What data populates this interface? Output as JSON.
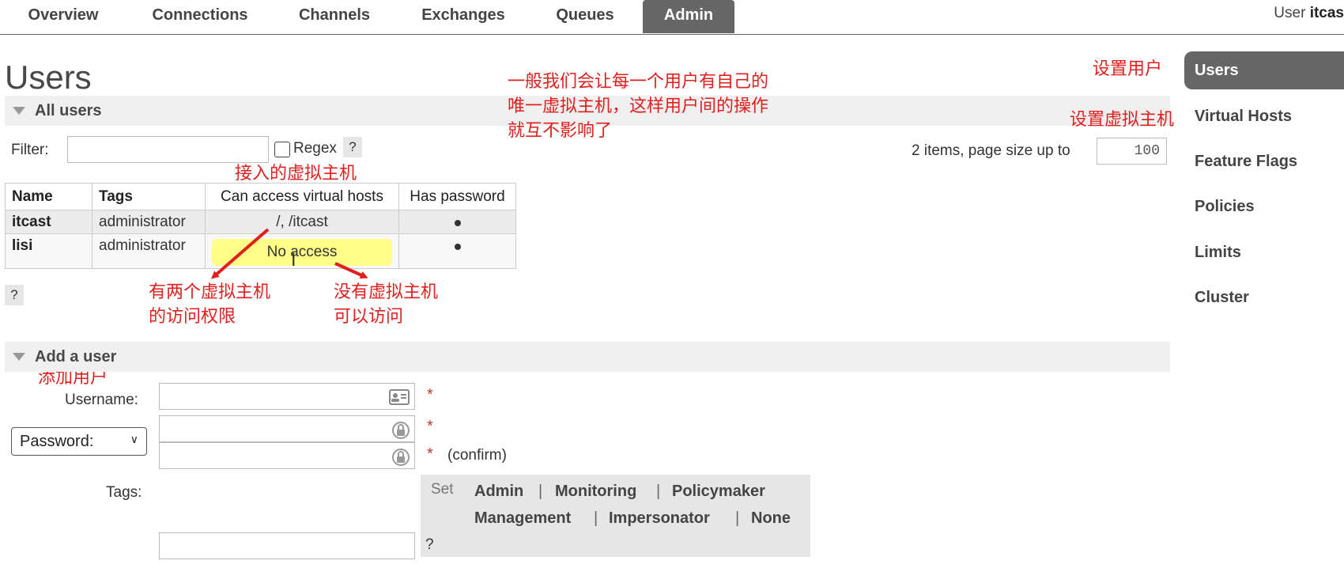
{
  "nav": {
    "tabs": [
      "Overview",
      "Connections",
      "Channels",
      "Exchanges",
      "Queues",
      "Admin"
    ],
    "active_tab": "Admin",
    "user_prefix": "User",
    "user_name": "itcas"
  },
  "page": {
    "title": "Users"
  },
  "all_users": {
    "header": "All users",
    "filter_label": "Filter:",
    "filter_value": "",
    "regex_label": "Regex",
    "help": "?",
    "items_label": "2 items, page size up to",
    "page_size": "100",
    "columns": [
      "Name",
      "Tags",
      "Can access virtual hosts",
      "Has password"
    ],
    "rows": [
      {
        "name": "itcast",
        "tags": "administrator",
        "vhosts": "/, /itcast",
        "has_password": "●"
      },
      {
        "name": "lisi",
        "tags": "administrator",
        "vhosts": "No access",
        "has_password": "●"
      }
    ],
    "bottom_help": "?"
  },
  "add_user": {
    "header": "Add a user",
    "username_label": "Username:",
    "password_select": "Password:",
    "required_mark": "*",
    "confirm_label": "(confirm)",
    "tags_label": "Tags:",
    "set_label": "Set",
    "tags": [
      "Admin",
      "Monitoring",
      "Policymaker",
      "Management",
      "Impersonator",
      "None"
    ],
    "separator": "|",
    "tags_help": "?"
  },
  "sidebar": {
    "items": [
      "Users",
      "Virtual Hosts",
      "Feature Flags",
      "Policies",
      "Limits",
      "Cluster"
    ],
    "active": "Users"
  },
  "annotations": {
    "main_note": [
      "一般我们会让每一个用户有自己的",
      "唯一虚拟主机，这样用户间的操作",
      "就互不影响了"
    ],
    "vhost_column": "接入的虚拟主机",
    "two_vhosts": [
      "有两个虚拟主机",
      "的访问权限"
    ],
    "no_vhost": [
      "没有虚拟主机",
      "可以访问"
    ],
    "set_user": "设置用户",
    "set_vhost": "设置虚拟主机",
    "add_user": "添加用户"
  },
  "colors": {
    "annotation": "#e0201e",
    "active_tab": "#666666",
    "highlight": "#ffff88"
  }
}
